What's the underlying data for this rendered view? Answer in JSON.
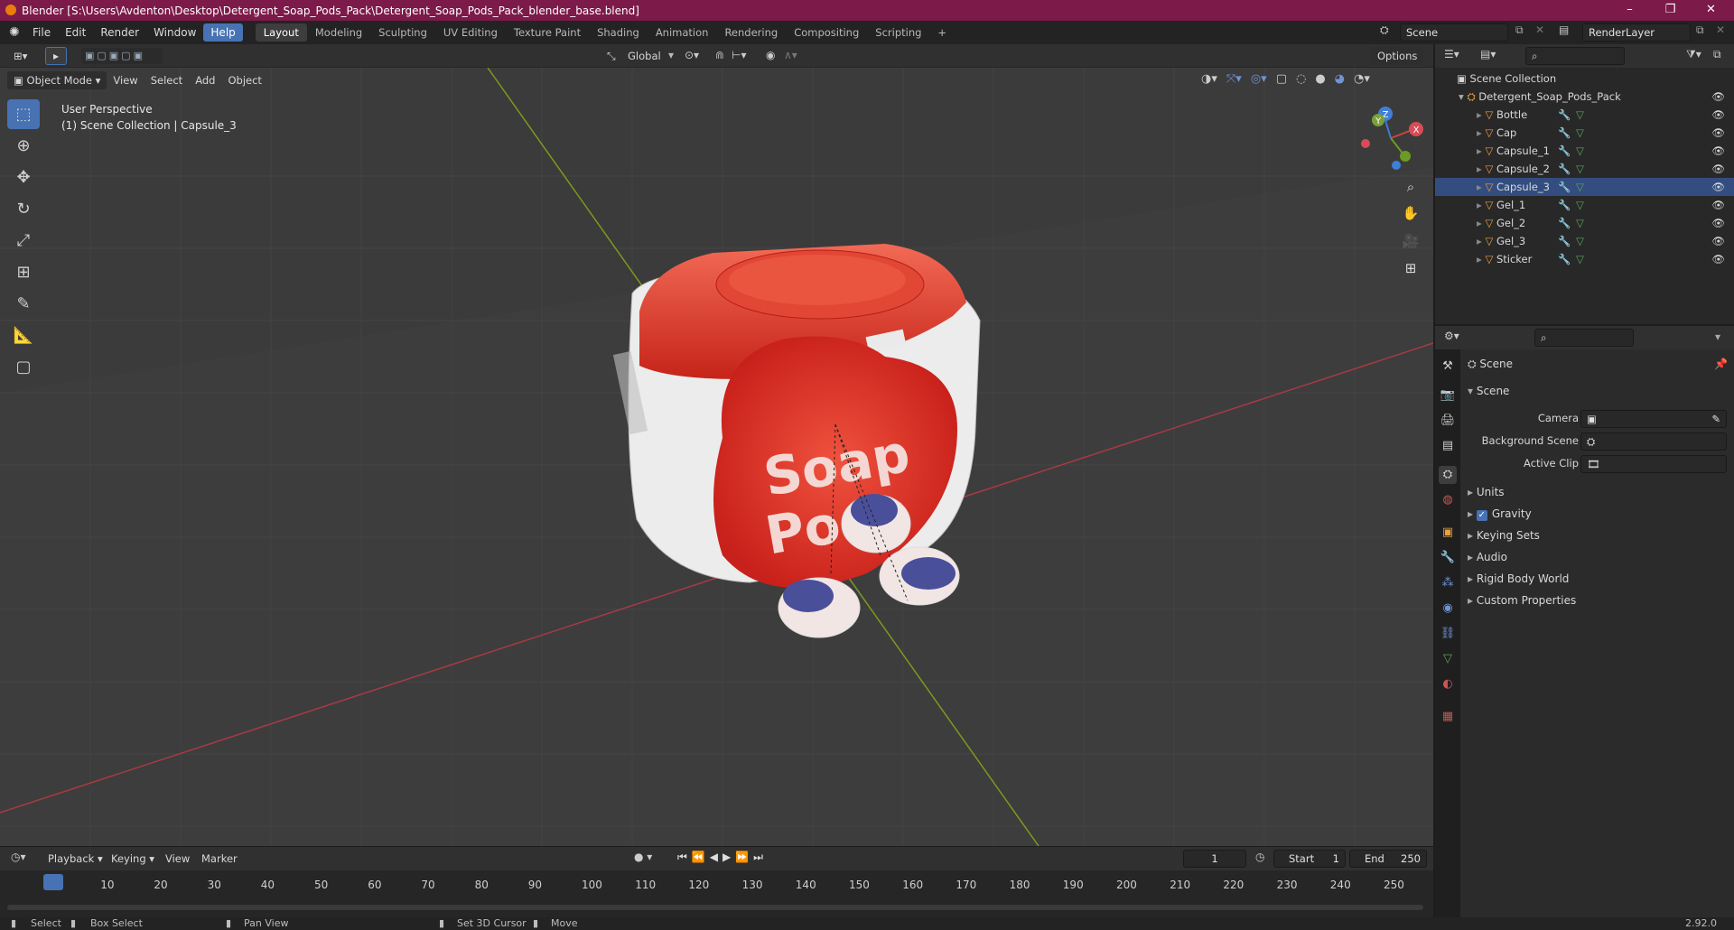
{
  "window": {
    "title": "Blender [S:\\Users\\Avdenton\\Desktop\\Detergent_Soap_Pods_Pack\\Detergent_Soap_Pods_Pack_blender_base.blend]"
  },
  "menu": {
    "items": [
      "File",
      "Edit",
      "Render",
      "Window",
      "Help"
    ],
    "active": "Help"
  },
  "workspaces": {
    "tabs": [
      "Layout",
      "Modeling",
      "Sculpting",
      "UV Editing",
      "Texture Paint",
      "Shading",
      "Animation",
      "Rendering",
      "Compositing",
      "Scripting"
    ],
    "active": "Layout",
    "add": "+"
  },
  "scene": {
    "name": "Scene",
    "layer": "RenderLayer"
  },
  "viewport_tools": {
    "orientation": "Global",
    "options": "Options"
  },
  "viewport_header": {
    "mode": "Object Mode",
    "menus": [
      "View",
      "Select",
      "Add",
      "Object"
    ]
  },
  "viewport": {
    "perspective": "User Perspective",
    "context": "(1) Scene Collection | Capsule_3",
    "model_text_1": "Soap",
    "model_text_2": "Pods",
    "gizmo": {
      "x": "X",
      "y": "Y",
      "z": "Z"
    }
  },
  "outliner": {
    "root": "Scene Collection",
    "collection": "Detergent_Soap_Pods_Pack",
    "objects": [
      "Bottle",
      "Cap",
      "Capsule_1",
      "Capsule_2",
      "Capsule_3",
      "Gel_1",
      "Gel_2",
      "Gel_3",
      "Sticker"
    ],
    "selected": "Capsule_3"
  },
  "properties": {
    "context": "Scene",
    "panel": "Scene",
    "camera_label": "Camera",
    "background_label": "Background Scene",
    "clip_label": "Active Clip",
    "sections": [
      "Units",
      "Gravity",
      "Keying Sets",
      "Audio",
      "Rigid Body World",
      "Custom Properties"
    ],
    "gravity_checked": true
  },
  "timeline": {
    "menus": [
      "Playback",
      "Keying",
      "View",
      "Marker"
    ],
    "current_frame": "1",
    "start_label": "Start",
    "start": "1",
    "end_label": "End",
    "end": "250",
    "ticks": [
      "1",
      "10",
      "20",
      "30",
      "40",
      "50",
      "60",
      "70",
      "80",
      "90",
      "100",
      "110",
      "120",
      "130",
      "140",
      "150",
      "160",
      "170",
      "180",
      "190",
      "200",
      "210",
      "220",
      "230",
      "240",
      "250"
    ]
  },
  "statusbar": {
    "select": "Select",
    "box_select": "Box Select",
    "pan_view": "Pan View",
    "set_cursor": "Set 3D Cursor",
    "move": "Move",
    "version": "2.92.0"
  },
  "colors": {
    "accent": "#4772b3",
    "title": "#7c1a49",
    "x_axis": "#a83a43",
    "y_axis": "#7a9a1d"
  }
}
